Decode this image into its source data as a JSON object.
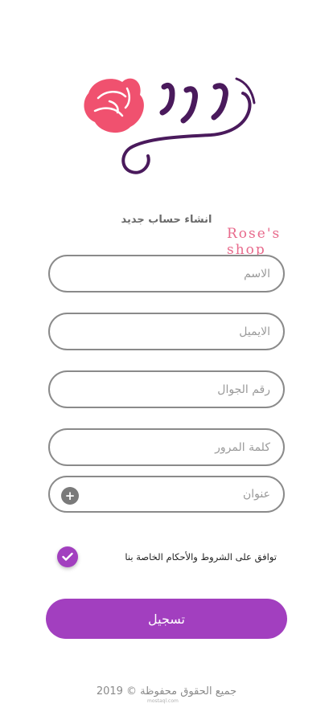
{
  "logo": {
    "name": "ورد",
    "tagline": "Rose's shop",
    "colors": {
      "rose": "#f0516f",
      "wordmark": "#4a1a5c",
      "tagline": "#e86a8c"
    }
  },
  "form": {
    "title": "انشاء حساب جديد",
    "name_placeholder": "الاسم",
    "email_placeholder": "الايميل",
    "phone_placeholder": "رقم الجوال",
    "password_placeholder": "كلمة المرور",
    "address_placeholder": "عنوان",
    "address_add_icon": "plus-icon",
    "terms_label": "توافق على الشروط والأحكام الخاصة بنا",
    "terms_checked": true,
    "submit_label": "تسجيل"
  },
  "footer": {
    "copyright": "جميع الحقوق محفوظة © 2019",
    "watermark": "mostaql.com"
  },
  "colors": {
    "accent": "#a23fbf",
    "border": "#8a8a8a",
    "background": "#ffffff"
  }
}
